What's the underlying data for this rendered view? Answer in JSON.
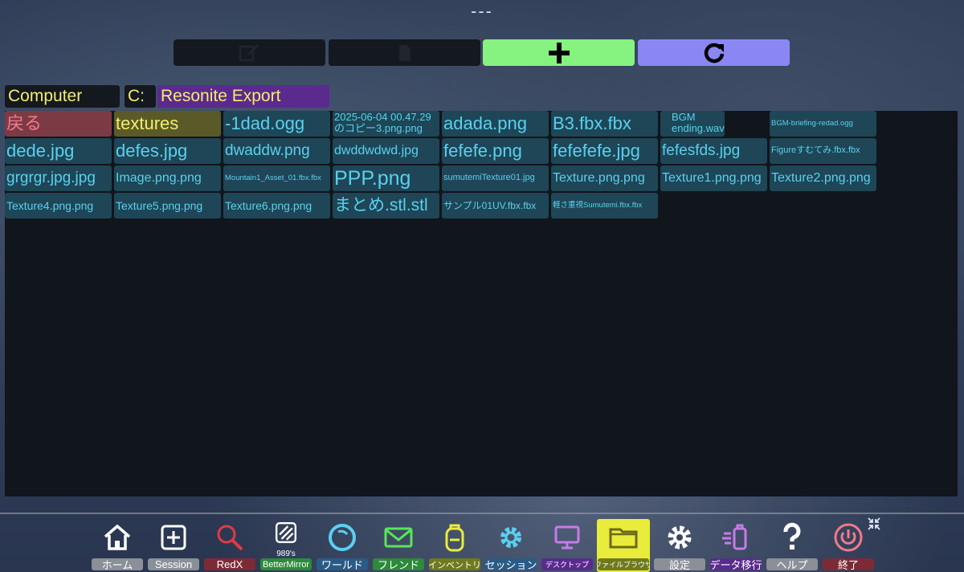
{
  "window": {
    "title_mark": "---"
  },
  "toolbar": {
    "buttons": [
      {
        "name": "edit-button",
        "icon": "edit-icon",
        "color": "#14181f"
      },
      {
        "name": "file-button",
        "icon": "file-icon",
        "color": "#14181f"
      },
      {
        "name": "add-button",
        "icon": "plus-icon",
        "color": "#86f27f"
      },
      {
        "name": "refresh-button",
        "icon": "refresh-icon",
        "color": "#8a87f4"
      }
    ]
  },
  "path": {
    "root": "Computer",
    "drive": "C:",
    "folder": "Resonite Export"
  },
  "files": [
    {
      "label": "戻る",
      "kind": "back"
    },
    {
      "label": "textures",
      "kind": "folder"
    },
    {
      "label": "-1dad.ogg",
      "kind": "file"
    },
    {
      "label": "2025-06-04 00.47.29のコピー3.png.png",
      "kind": "file"
    },
    {
      "label": "adada.png",
      "kind": "file"
    },
    {
      "label": "B3.fbx.fbx",
      "kind": "file"
    },
    {
      "label": "BGM ending.wav",
      "kind": "file"
    },
    {
      "label": "BGM-briefing-redad.ogg",
      "kind": "file"
    },
    {
      "label": "dede.jpg",
      "kind": "file"
    },
    {
      "label": "defes.jpg",
      "kind": "file"
    },
    {
      "label": "dwaddw.png",
      "kind": "file"
    },
    {
      "label": "dwddwdwd.jpg",
      "kind": "file"
    },
    {
      "label": "fefefe.png",
      "kind": "file"
    },
    {
      "label": "fefefefe.jpg",
      "kind": "file"
    },
    {
      "label": "fefesfds.jpg",
      "kind": "file"
    },
    {
      "label": "Figureすむてみ.fbx.fbx",
      "kind": "file"
    },
    {
      "label": "grgrgr.jpg.jpg",
      "kind": "file"
    },
    {
      "label": "Image.png.png",
      "kind": "file"
    },
    {
      "label": "Mountain1_Asset_01.fbx.fbx",
      "kind": "file"
    },
    {
      "label": "PPP.png",
      "kind": "file"
    },
    {
      "label": "sumutemiTexture01.jpg",
      "kind": "file"
    },
    {
      "label": "Texture.png.png",
      "kind": "file"
    },
    {
      "label": "Texture1.png.png",
      "kind": "file"
    },
    {
      "label": "Texture2.png.png",
      "kind": "file"
    },
    {
      "label": "Texture4.png.png",
      "kind": "file"
    },
    {
      "label": "Texture5.png.png",
      "kind": "file"
    },
    {
      "label": "Texture6.png.png",
      "kind": "file"
    },
    {
      "label": "まとめ.stl.stl",
      "kind": "file"
    },
    {
      "label": "サンプル01UV.fbx.fbx",
      "kind": "file"
    },
    {
      "label": "軽さ重視Sumutemi.fbx.fbx",
      "kind": "file"
    }
  ],
  "dock": [
    {
      "label": "ホーム",
      "icon": "home-icon",
      "color": "#8a8f98"
    },
    {
      "label": "Session",
      "icon": "plus-square-icon",
      "color": "#8a8f98"
    },
    {
      "label": "RedX",
      "icon": "magnifier-icon",
      "color": "#7c2b36"
    },
    {
      "label": "BetterMirror",
      "sub": "989's",
      "icon": "mirror-icon",
      "color": "#2d8a3a"
    },
    {
      "label": "ワールド",
      "icon": "world-icon",
      "color": "#2a5b86"
    },
    {
      "label": "フレンド",
      "icon": "mail-icon",
      "color": "#2d8a3a"
    },
    {
      "label": "インベントリ",
      "icon": "backpack-icon",
      "color": "#6f7a1e"
    },
    {
      "label": "セッション",
      "icon": "gear-blue-icon",
      "color": "#2a5b86"
    },
    {
      "label": "デスクトップ",
      "icon": "monitor-icon",
      "color": "#5a2a8e"
    },
    {
      "label": "ファイルブラウザ",
      "icon": "folder-icon",
      "color": "#6f7a1e"
    },
    {
      "label": "設定",
      "icon": "gear-icon",
      "color": "#8a8f98"
    },
    {
      "label": "データ移行",
      "icon": "transfer-icon",
      "color": "#5a2a8e"
    },
    {
      "label": "ヘルプ",
      "icon": "question-icon",
      "color": "#8a8f98"
    },
    {
      "label": "終了",
      "icon": "power-icon",
      "color": "#7c2b36"
    }
  ]
}
